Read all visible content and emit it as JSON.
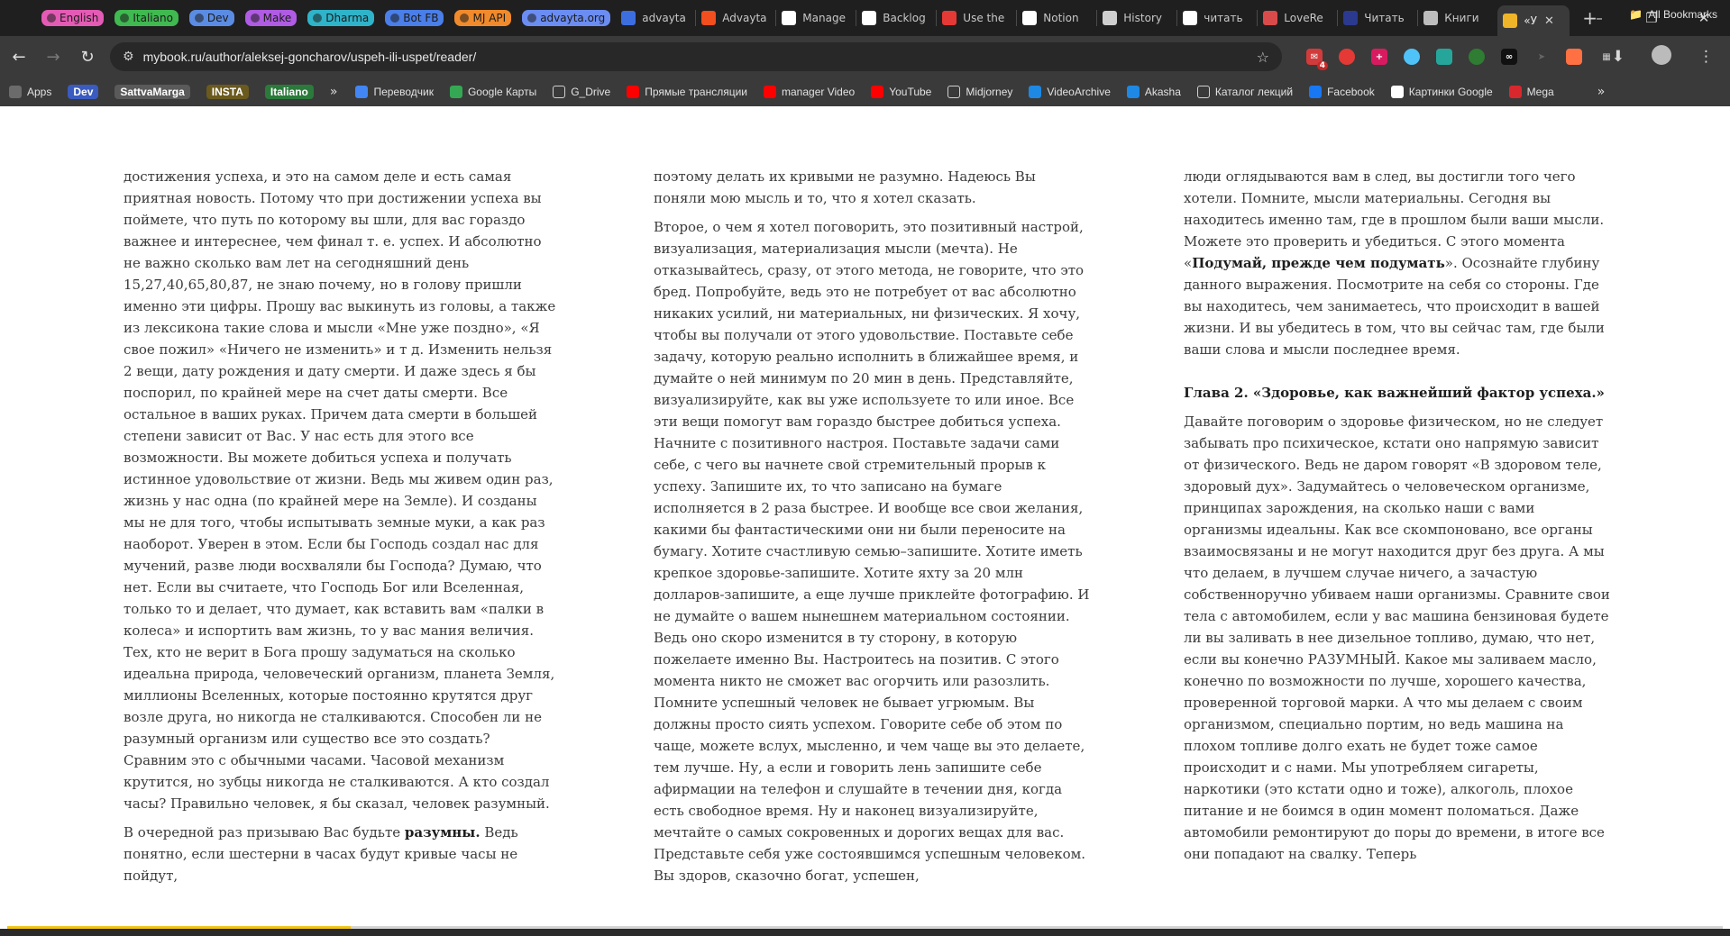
{
  "browser": {
    "tabs": [
      {
        "label": "English",
        "style": "pill",
        "color": "#e35bb4"
      },
      {
        "label": "Italiano",
        "style": "pill",
        "color": "#3fb950"
      },
      {
        "label": "Dev",
        "style": "pill",
        "color": "#5b8ce3"
      },
      {
        "label": "Make",
        "style": "pill",
        "color": "#b05be3"
      },
      {
        "label": "Dharma",
        "style": "pill",
        "color": "#2fb3c9"
      },
      {
        "label": "Bot FB",
        "style": "pill",
        "color": "#4a7ee8"
      },
      {
        "label": "MJ API",
        "style": "pill",
        "color": "#f08a2c"
      },
      {
        "label": "advayta.org",
        "style": "pill",
        "color": "#6b8df2"
      },
      {
        "label": "advayta",
        "style": "plain",
        "icon": "page-icon",
        "color": "#3d6ee0"
      },
      {
        "label": "Advayta",
        "style": "plain",
        "icon": "figma-icon",
        "color": "#f24e1e"
      },
      {
        "label": "Manage",
        "style": "plain",
        "icon": "github-icon",
        "color": "#ffffff"
      },
      {
        "label": "Backlog",
        "style": "plain",
        "icon": "github-icon",
        "color": "#ffffff"
      },
      {
        "label": "Use the",
        "style": "plain",
        "icon": "app-icon",
        "color": "#e53935"
      },
      {
        "label": "Notion",
        "style": "plain",
        "icon": "notion-icon",
        "color": "#ffffff"
      },
      {
        "label": "History",
        "style": "plain",
        "icon": "history-icon",
        "color": "#cfcfcf"
      },
      {
        "label": "читать",
        "style": "plain",
        "icon": "google-icon",
        "color": "#ffffff"
      },
      {
        "label": "LoveRe",
        "style": "plain",
        "icon": "book-icon",
        "color": "#d94b4b"
      },
      {
        "label": "Читать",
        "style": "plain",
        "icon": "book-icon",
        "color": "#2b3a8f"
      },
      {
        "label": "Книги",
        "style": "plain",
        "icon": "pen-icon",
        "color": "#bdbdbd"
      },
      {
        "label": "«У",
        "style": "active",
        "icon": "mybook-icon",
        "color": "#f0b429"
      }
    ],
    "new_tab_glyph": "+",
    "address": {
      "url": "mybook.ru/author/aleksej-goncharov/uspeh-ili-uspet/reader/"
    },
    "bookmarks_tags": [
      {
        "label": "Dev",
        "color": "#3a5bbf"
      },
      {
        "label": "SattvaMarga",
        "color": "#5a5a5a"
      },
      {
        "label": "INSTA",
        "color": "#6b5a1e"
      },
      {
        "label": "Italiano",
        "color": "#2b7a3b"
      }
    ],
    "bookmarks": [
      {
        "label": "Apps",
        "icon": "apps-grid-icon"
      },
      {
        "label": "Переводчик",
        "icon": "translate-icon"
      },
      {
        "label": "Google Карты",
        "icon": "maps-icon"
      },
      {
        "label": "G_Drive",
        "icon": "folder-icon"
      },
      {
        "label": "Прямые трансляции",
        "icon": "youtube-icon"
      },
      {
        "label": "manager Video",
        "icon": "youtube-icon"
      },
      {
        "label": "YouTube",
        "icon": "youtube-icon"
      },
      {
        "label": "Midjorney",
        "icon": "folder-icon"
      },
      {
        "label": "VideoArchive",
        "icon": "archive-icon"
      },
      {
        "label": "Akasha",
        "icon": "akasha-icon"
      },
      {
        "label": "Каталог лекций",
        "icon": "catalog-icon"
      },
      {
        "label": "Facebook",
        "icon": "facebook-icon"
      },
      {
        "label": "Картинки Google",
        "icon": "google-icon"
      },
      {
        "label": "Mega",
        "icon": "mega-icon"
      }
    ],
    "all_bookmarks": "All Bookmarks",
    "more_glyph": "»",
    "extension_badge": "4"
  },
  "reader": {
    "col1": [
      "достижения успеха, и это на самом деле и есть самая приятная новость. Потому что при достижении успеха вы поймете, что путь по которому вы шли, для вас гораздо важнее и интереснее, чем финал т. е. успех. И абсолютно не важно сколько вам лет на сегодняшний день 15,27,40,65,80,87, не знаю почему, но в голову пришли именно эти цифры. Прошу вас выкинуть из головы, а также из лексикона такие слова и мысли «Мне уже поздно», «Я свое пожил» «Ничего не изменить» и т д. Изменить нельзя 2 вещи, дату рождения и дату смерти. И даже здесь я бы поспорил, по крайней мере на счет даты смерти. Все остальное в ваших руках. Причем дата смерти в большей степени зависит от Вас. У нас есть для этого все возможности. Вы можете добиться успеха и получать истинное удовольствие от жизни. Ведь мы живем один раз, жизнь у нас одна (по крайней мере на Земле). И созданы мы не для того, чтобы испытывать земные муки, а как раз наоборот. Уверен в этом. Если бы Господь создал нас для мучений, разве люди восхваляли бы Господа? Думаю, что нет. Если вы считаете, что Господь Бог или Вселенная, только то и делает, что думает, как вставить вам «палки в колеса» и испортить вам жизнь, то у вас мания величия. Тех, кто не верит в Бога прошу задуматься на сколько идеальна природа, человеческий организм, планета Земля, миллионы Вселенных, которые постоянно крутятся друг возле друга, но никогда не сталкиваются. Способен ли не разумный организм или существо все это создать? Сравним это с обычными часами. Часовой механизм крутится, но зубцы никогда не сталкиваются. А кто создал часы? Правильно человек, я бы сказал, человек разумный."
    ],
    "col1_p2_before": "В очередной раз призываю Вас будьте ",
    "col1_p2_bold": "разумны.",
    "col1_p2_after": " Ведь понятно, если шестерни в часах будут кривые часы не пойдут,",
    "col2": [
      "поэтому делать их кривыми не разумно. Надеюсь Вы поняли мою мысль и то, что я хотел сказать.",
      "Второе, о чем я хотел поговорить, это позитивный настрой, визуализация, материализация мысли (мечта). Не отказывайтесь, сразу, от этого метода, не говорите, что это бред. Попробуйте, ведь это не потребует от вас абсолютно никаких усилий, ни материальных, ни физических. Я хочу, чтобы вы получали от этого удовольствие. Поставьте себе задачу, которую реально исполнить в ближайшее время, и думайте о ней минимум по 20 мин в день. Представляйте, визуализируйте, как вы уже используете то или иное. Все эти вещи помогут вам гораздо быстрее добиться успеха. Начните с позитивного настроя. Поставьте задачи сами себе, с чего вы начнете свой стремительный прорыв к успеху. Запишите их, то что записано на бумаге исполняется в 2 раза быстрее. И вообще все свои желания, какими бы фантастическими они ни были переносите на бумагу. Хотите счастливую семью–запишите. Хотите иметь крепкое здоровье-запишите. Хотите яхту за 20 млн долларов-запишите, а еще лучше приклейте фотографию. И не думайте о вашем нынешнем материальном состоянии. Ведь оно скоро изменится в ту сторону, в которую пожелаете именно Вы. Настроитесь на позитив. С этого момента никто не сможет вас огорчить или разозлить. Помните успешный человек не бывает угрюмым. Вы должны просто сиять успехом. Говорите себе об этом по чаще, можете вслух, мысленно, и чем чаще вы это делаете, тем лучше. Ну, а если и говорить лень запишите себе афирмации на телефон и слушайте в течении дня, когда есть свободное время. Ну и наконец визуализируйте, мечтайте о самых сокровенных и дорогих вещах для вас. Представьте себя уже состоявшимся успешным человеком. Вы здоров, сказочно богат, успешен,"
    ],
    "col3_p1_before": "люди оглядываются вам в след, вы достигли того чего хотели. Помните, мысли материальны. Сегодня вы находитесь именно там, где в прошлом были ваши мысли. Можете это проверить и убедиться. С этого момента «",
    "col3_p1_bold": "Подумай, прежде чем подумать",
    "col3_p1_after": "». Осознайте глубину данного выражения. Посмотрите на себя со стороны. Где вы находитесь, чем занимаетесь, что происходит в вашей жизни. И вы убедитесь в том, что вы сейчас там, где были ваши слова и мысли последнее время.",
    "chapter_title": "Глава 2. «Здоровье, как важнейший фактор успеха.»",
    "col3_p2": "Давайте поговорим о здоровье физическом, но не следует забывать про психическое, кстати оно напрямую зависит от физического. Ведь не даром говорят «В здоровом теле, здоровый дух». Задумайтесь о человеческом организме, принципах зарождения, на сколько наши с вами организмы идеальны. Как все скомпоновано, все органы взаимосвязаны и не могут находится друг без друга. А мы что делаем, в лучшем случае ничего, а зачастую собственноручно убиваем наши организмы. Сравните свои тела с автомобилем, если у вас машина бензиновая будете ли вы заливать в нее дизельное топливо, думаю, что нет, если вы конечно РАЗУМНЫЙ. Какое мы заливаем масло, конечно по возможности по лучше, хорошего качества, проверенной торговой марки. А что мы делаем с своим организмом, специально портим, но ведь машина на плохом топливе долго ехать не будет тоже самое происходит и с нами. Мы употребляем сигареты, наркотики (это кстати одно и тоже), алкоголь, плохое питание и не боимся в один момент поломаться. Даже автомобили ремонтируют до поры до времени, в итоге все они попадают на свалку. Теперь",
    "progress_fraction": 0.2,
    "progress_color": "#f0c419"
  }
}
